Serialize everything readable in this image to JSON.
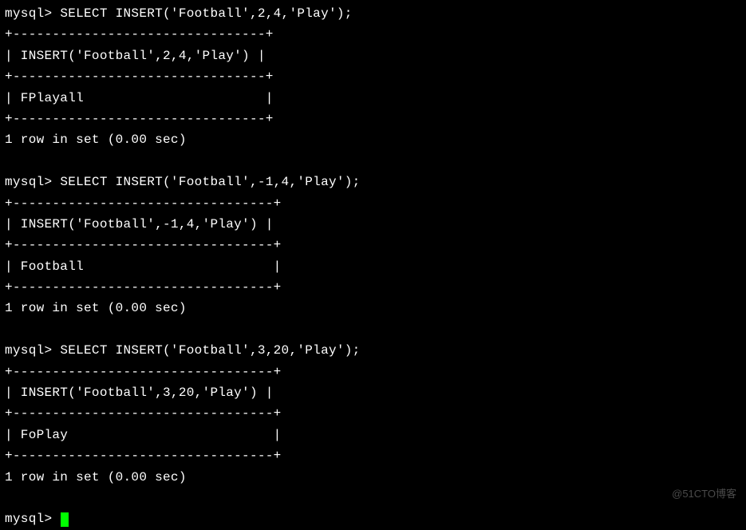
{
  "terminal": {
    "prompt": "mysql> ",
    "queries": [
      {
        "command": "SELECT INSERT('Football',2,4,'Play');",
        "border": "+--------------------------------+",
        "header": "| INSERT('Football',2,4,'Play') |",
        "result": "| FPlayall                       |",
        "footer": "1 row in set (0.00 sec)"
      },
      {
        "command": "SELECT INSERT('Football',-1,4,'Play');",
        "border": "+---------------------------------+",
        "header": "| INSERT('Football',-1,4,'Play') |",
        "result": "| Football                        |",
        "footer": "1 row in set (0.00 sec)"
      },
      {
        "command": "SELECT INSERT('Football',3,20,'Play');",
        "border": "+---------------------------------+",
        "header": "| INSERT('Football',3,20,'Play') |",
        "result": "| FoPlay                          |",
        "footer": "1 row in set (0.00 sec)"
      }
    ],
    "final_prompt": "mysql> "
  },
  "watermark": "@51CTO博客"
}
